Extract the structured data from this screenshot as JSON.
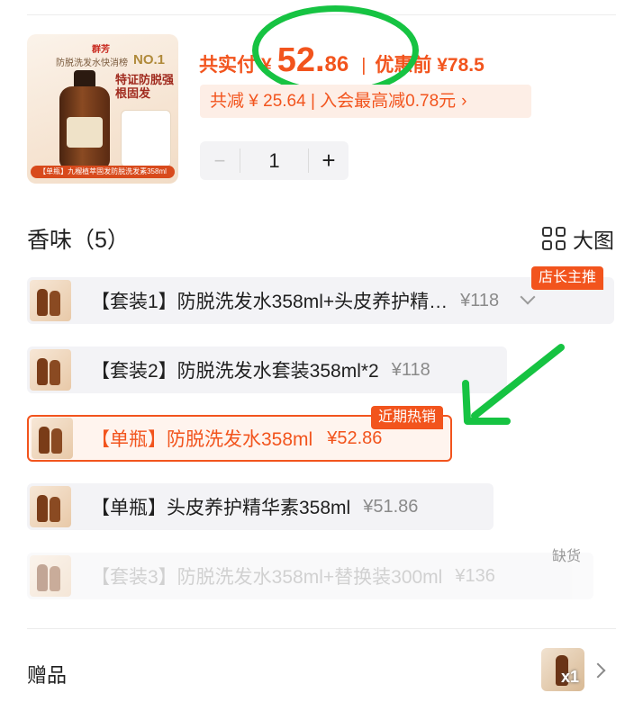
{
  "product": {
    "image": {
      "brand": "群芳",
      "subtitle": "防脱洗发水快消榜",
      "rank": "NO.1",
      "claim": "特证防脱强根固发",
      "banner": "【单瓶】九榴植萃固发防脱洗发素358ml"
    },
    "price_label": "共实付",
    "currency": "¥",
    "price_int": "52.",
    "price_dec": "86",
    "separator": "|",
    "original_price": "优惠前 ¥78.5",
    "discount_text": "共减 ¥ 25.64 | 入会最高减0.78元",
    "discount_chevron": "›",
    "quantity": "1",
    "minus": "−",
    "plus": "+"
  },
  "section": {
    "title": "香味（5）",
    "view_toggle": "大图"
  },
  "options": [
    {
      "label": "【套装1】防脱洗发水358ml+头皮养护精…",
      "price": "¥118",
      "tag": "店长主推"
    },
    {
      "label": "【套装2】防脱洗发水套装358ml*2",
      "price": "¥118"
    },
    {
      "label": "【单瓶】防脱洗发水358ml",
      "price": "¥52.86",
      "tag": "近期热销",
      "selected": true
    },
    {
      "label": "【单瓶】头皮养护精华素358ml",
      "price": "¥51.86"
    },
    {
      "label": "【套装3】防脱洗发水358ml+替换装300ml",
      "price": "¥136",
      "status": "缺货"
    }
  ],
  "gift": {
    "label": "赠品",
    "quantity": "x1"
  },
  "colors": {
    "accent": "#f2541d",
    "highlight_circle": "#16c342",
    "option_bg": "#f3f3f6"
  }
}
